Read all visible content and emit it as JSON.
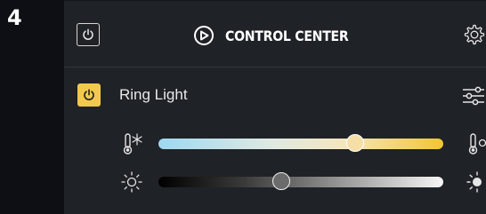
{
  "step": {
    "number": "4"
  },
  "header": {
    "title": "CONTROL CENTER"
  },
  "light": {
    "name": "Ring Light",
    "on": true
  },
  "sliders": {
    "temperature": {
      "value": 0.69
    },
    "brightness": {
      "value": 0.43
    }
  },
  "colors": {
    "accent": "#f2c94c",
    "panel": "#1f2226",
    "background": "#0d0f14"
  },
  "icons": [
    "power-icon",
    "elgato-logo-icon",
    "gear-icon",
    "adjust-icon",
    "thermometer-cold-icon",
    "thermometer-warm-icon",
    "brightness-low-icon",
    "brightness-high-icon"
  ]
}
